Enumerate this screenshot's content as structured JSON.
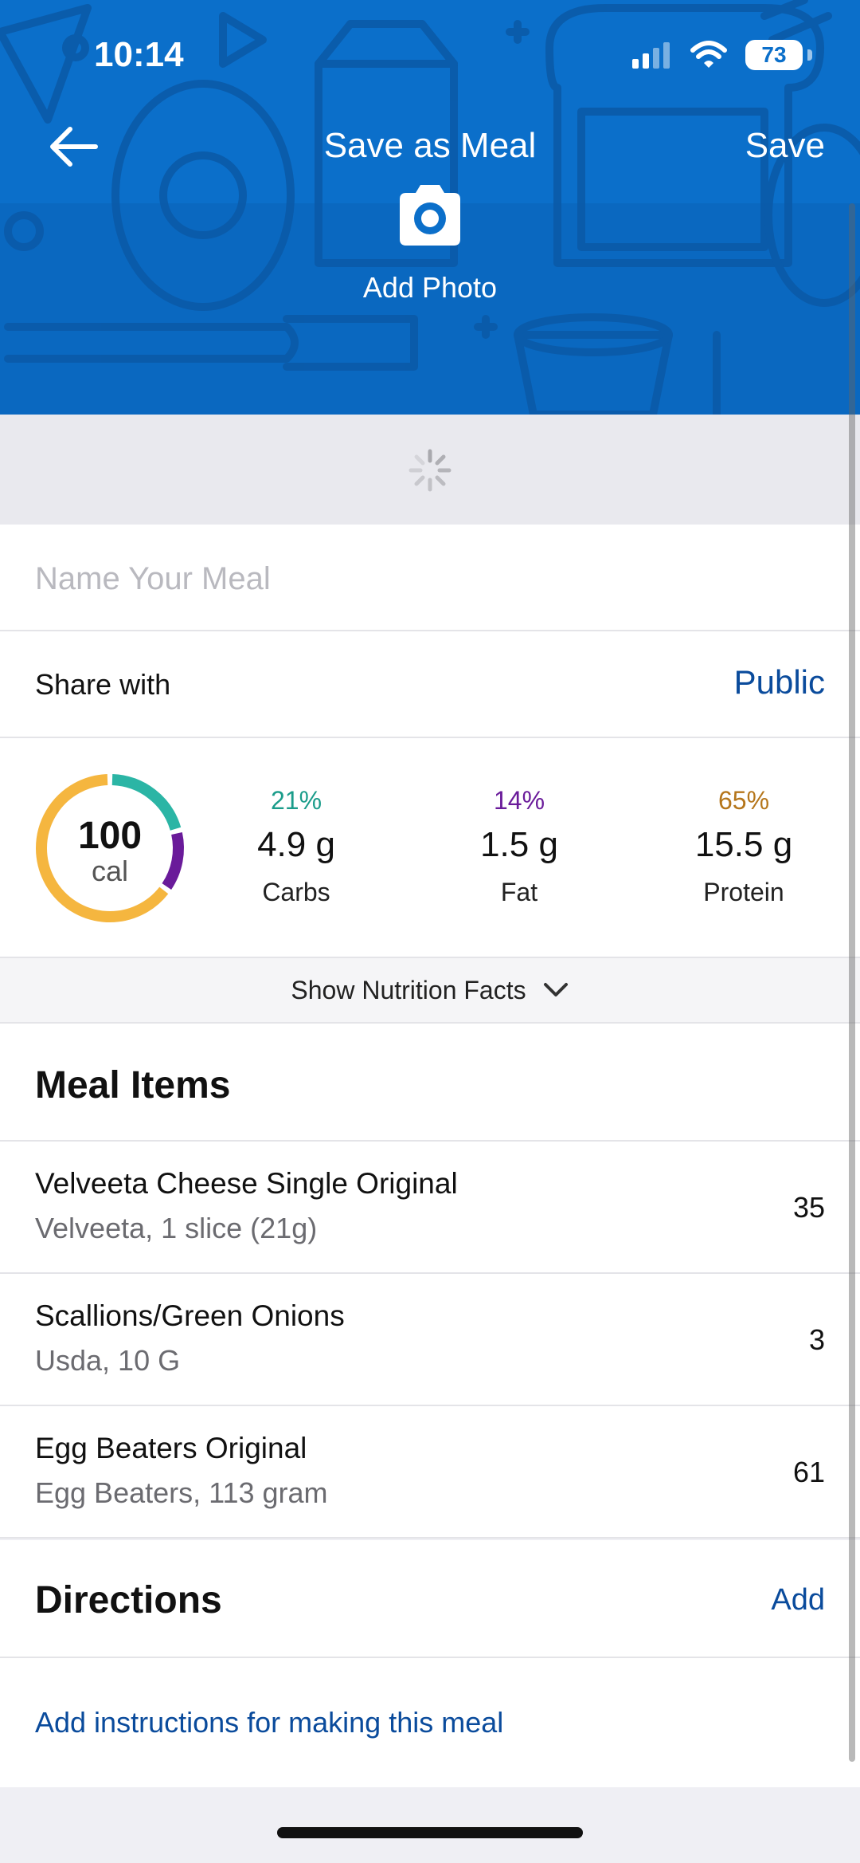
{
  "status_bar": {
    "time": "10:14",
    "battery": "73"
  },
  "nav": {
    "title": "Save as Meal",
    "save_label": "Save",
    "add_photo_label": "Add Photo"
  },
  "meal_name": {
    "placeholder": "Name Your Meal",
    "value": ""
  },
  "share": {
    "label": "Share with",
    "value": "Public"
  },
  "summary": {
    "calories": "100",
    "calories_unit": "cal",
    "macros": [
      {
        "percent": "21%",
        "amount": "4.9 g",
        "label": "Carbs",
        "color": "#1a9c8a",
        "fraction": 0.21
      },
      {
        "percent": "14%",
        "amount": "1.5 g",
        "label": "Fat",
        "color": "#6a1b9a",
        "fraction": 0.14
      },
      {
        "percent": "65%",
        "amount": "15.5 g",
        "label": "Protein",
        "color": "#b5761b",
        "fraction": 0.65
      }
    ],
    "ring_colors": {
      "carbs": "#2bb5a5",
      "fat": "#6a1b9a",
      "protein": "#f5b63f"
    }
  },
  "nutrition_toggle": {
    "label": "Show Nutrition Facts"
  },
  "meal_items": {
    "title": "Meal Items",
    "items": [
      {
        "name": "Velveeta Cheese Single Original",
        "desc": "Velveeta, 1 slice (21g)",
        "calories": "35"
      },
      {
        "name": "Scallions/Green Onions",
        "desc": "Usda, 10 G",
        "calories": "3"
      },
      {
        "name": "Egg Beaters Original",
        "desc": "Egg Beaters, 113 gram",
        "calories": "61"
      }
    ]
  },
  "directions": {
    "title": "Directions",
    "add_label": "Add",
    "instructions_link": "Add instructions for making this meal"
  },
  "colors": {
    "brand_blue": "#0b6fca",
    "link_blue": "#0a4b9c"
  }
}
